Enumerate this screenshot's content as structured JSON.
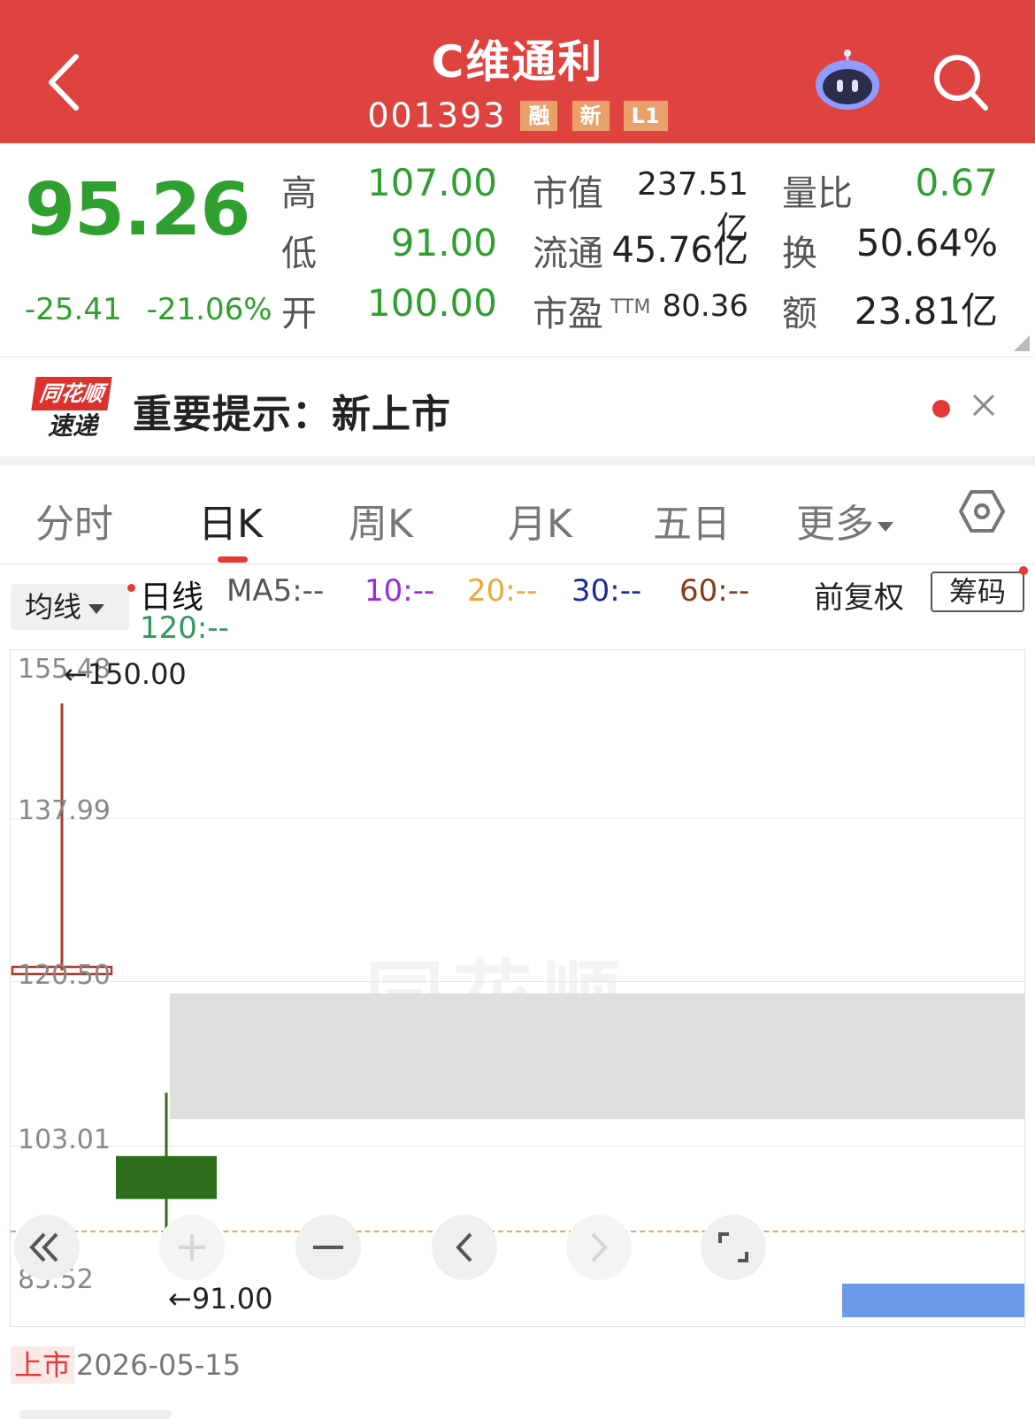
{
  "header": {
    "title": "C维通利",
    "code": "001393",
    "badges": [
      "融",
      "新",
      "L1"
    ],
    "background_color": "#de4340"
  },
  "quote": {
    "price": "95.26",
    "change": "-25.41",
    "change_pct": "-21.06%",
    "high_label": "高",
    "high": "107.00",
    "low_label": "低",
    "low": "91.00",
    "open_label": "开",
    "open": "100.00",
    "mktcap_label": "市值",
    "mktcap": "237.51亿",
    "float_label": "流通",
    "float": "45.76亿",
    "pe_label": "市盈",
    "pe_sup": "TTM",
    "pe": "80.36",
    "volratio_label": "量比",
    "volratio": "0.67",
    "turnover_label": "换",
    "turnover": "50.64%",
    "amount_label": "额",
    "amount": "23.81亿",
    "down_color": "#2f9f2f"
  },
  "notice": {
    "logo_top": "同花顺",
    "logo_bottom": "速递",
    "text": "重要提示：新上市"
  },
  "tabs": [
    "分时",
    "日K",
    "周K",
    "月K",
    "五日",
    "更多"
  ],
  "ma_bar": {
    "avg_label": "均线",
    "line_label": "日线",
    "ma5": "MA5:--",
    "ma10": "10:--",
    "ma20": "20:--",
    "ma30": "30:--",
    "ma60": "60:--",
    "ma120": "120:--",
    "adjust": "前复权",
    "chips": "筹码",
    "colors": {
      "ma10": "#9b2bd6",
      "ma20": "#e8a93a",
      "ma30": "#1c2b9c",
      "ma60": "#8b3a1a",
      "ma120": "#2e9a5a"
    }
  },
  "chart": {
    "y_ticks": [
      "155.48",
      "137.99",
      "120.50",
      "103.01",
      "85.52"
    ],
    "high_annotation": "←150.00",
    "low_annotation": "←91.00",
    "watermark": "同花顺"
  },
  "chart_data": {
    "type": "candlestick",
    "ylim": [
      85.52,
      155.48
    ],
    "y_ticks": [
      155.48,
      137.99,
      120.5,
      103.01,
      85.52
    ],
    "candles": [
      {
        "open": 120.5,
        "close": 120.5,
        "high": 150.0,
        "low": 120.5,
        "color": "#b03a2e"
      },
      {
        "open": 100.0,
        "close": 95.26,
        "high": 107.0,
        "low": 91.0,
        "color": "#2c6e1a"
      }
    ],
    "annotations": [
      "←150.00",
      "←91.00"
    ]
  },
  "footer": {
    "listing_tag": "上市",
    "listing_date": "2026-05-15"
  }
}
